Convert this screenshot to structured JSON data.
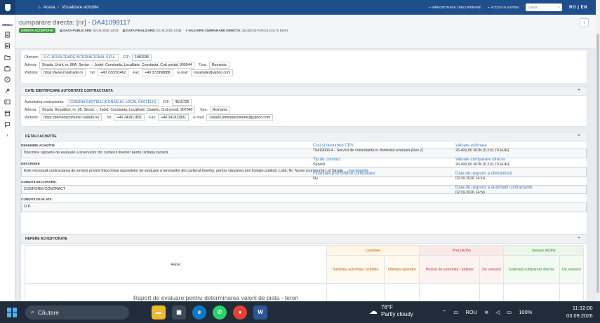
{
  "topbar": {
    "home": "Acasa",
    "breadcrumb": "Vizualizare achizitie",
    "register": "INREGISTRARE / RECUPERARE",
    "login": "ACCES IN SISTEM",
    "search_placeholder": "Cauta...",
    "lang": "RO | EN"
  },
  "sidebar": {
    "menu": "MENIU"
  },
  "header": {
    "title_prefix": "cumparare directa: [nr] - ",
    "title_number": "DA41099117",
    "badge": "OFERTA ACCEPTATA",
    "pub_label": "DATA PUBLICARE:",
    "pub_value": "02.09.2026 14:03",
    "fin_label": "DATA FINALIZARE:",
    "fin_value": "02.09.2026 14:56",
    "val_label": "VALOARE CUMPARARE DIRECTA:",
    "val_value": "26.400,00 RON (5.210,70 EUR)"
  },
  "ofertant": {
    "label": "Ofertant:",
    "name": "S.C. ROSA TRADE INTERNATIONAL S.R.L.",
    "cif_label": "CIF:",
    "cif": "1882036",
    "addr_label": "Adresa:",
    "addr": "Strada: Unirii, nr. 86A, Sector: -, Judet: Constanta, Localitate: Constanta, Cod postal: 900544",
    "tara_label": "Tara:",
    "tara": "Romania",
    "web_label": "Website:",
    "web": "https://www.rosatrade.ro",
    "tel_label": "Tel:",
    "tel": "+40 722201462",
    "fax_label": "Fax:",
    "fax": "+40 372898888",
    "email_label": "E-mail:",
    "email": "rosatrade@yahoo.com"
  },
  "autoritate": {
    "section": "DATE IDENTIFICARE AUTORITATE CONTRACTANTA",
    "label": "Autoritatea contractanta:",
    "name": "COMUNA CASTELU (CONSILIUL LOCAL CASTELU)",
    "cif_label": "CIF:",
    "cif": "4515735",
    "addr_label": "Adresa:",
    "addr": "Strada: Republicii, nr. 58, Sector: -, Judet: Constanta, Localitate: Castelu, Cod postal: 907040",
    "tara_label": "Tara:",
    "tara": "Romania",
    "web_label": "Website:",
    "web": "https://primariacomunei castelu.ro/",
    "tel_label": "Tel:",
    "tel": "+40 241811831",
    "fax_label": "Fax:",
    "fax": "+40 241811831",
    "email_label": "E-mail:",
    "email": "castelu.primariacomunei@yahoo.com"
  },
  "detalii": {
    "section": "DETALII ACHIZITIE",
    "den_label": "DENUMIRE ACHIZITIE",
    "den": "Întocmire rapoarte de evaluare a terenurilor din cartierul tinerilor pentru licitația publică",
    "desc_label": "DESCRIERE",
    "desc": "Este necesară contractarea de servicii privind întocmirea rapoartelor de evaluare a terenurilor din cartierul tinerilor, pentru vânzarea prin licitație publică. Listă: Nr. Nume și prenume Lot Strada ...",
    "more": "mai departe",
    "livrare_label": "CONDITII DE LIVRARE:",
    "livrare": "CONFORM CONTRACT",
    "plata_label": "CONDITII DE PLATA:",
    "plata": "O.P.",
    "cpv_label": "Cod si denumire CPV",
    "cpv": "79419000-4 - Servicii de consultanta in domeniul evaluarii (Rev.2)",
    "tip_label": "Tip de contract",
    "tip": "Servicii",
    "fin_label": "Finantare prin fonduri comunitare",
    "fin": "Nu",
    "vest_label": "Valoare estimata",
    "vest": "26.400,00 RON (5.210,70 EUR)",
    "vcd_label": "Valoare cumparare directa",
    "vcd": "26.400,00 RON (5.210,70 EUR)",
    "dro_label": "Data de raspuns a ofertantului",
    "dro": "02.09.2026 14:14",
    "dra_label": "Data de raspuns a autoritatii contractante",
    "dra": "02.09.2026 14:56"
  },
  "repere": {
    "section": "REPERE ACHIZITIONATE",
    "reper": "Reper",
    "cantitate": "Cantitate",
    "pret": "Pret (RON)",
    "valoare": "Valoare (RON)",
    "sub": [
      "Solicitata autoritate / entitate",
      "Ofertata operator",
      "Propus de autoritate / entitate",
      "De vanzare",
      "Estimata cumparare directa",
      "De vanzare"
    ],
    "row_text": "Raport de evaluare pentru determinarea valorii de piata - teren"
  },
  "taskbar": {
    "search": "Căutare",
    "temp": "76°F",
    "weather": "Partly cloudy",
    "lang": "ROU",
    "battery": "100%",
    "time": "11:32:00",
    "date": "03.09.2026"
  }
}
